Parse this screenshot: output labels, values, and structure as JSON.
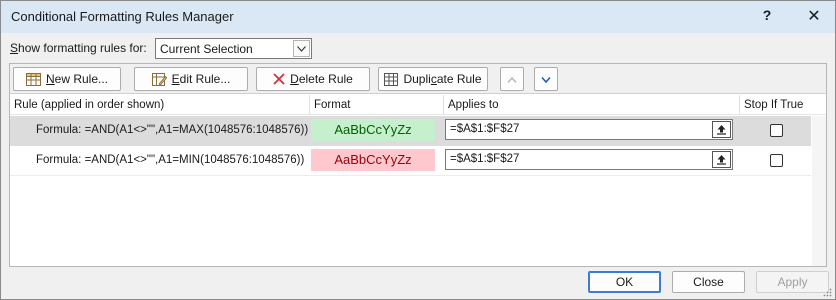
{
  "window": {
    "title": "Conditional Formatting Rules Manager",
    "help_label": "?",
    "close_label": "✕"
  },
  "filter": {
    "label_prefix": "S",
    "label_rest": "how formatting rules for:",
    "selected": "Current Selection"
  },
  "toolbar": {
    "new_rule_u": "N",
    "new_rule_rest": "ew Rule...",
    "edit_rule_u": "E",
    "edit_rule_rest": "dit Rule...",
    "delete_rule_u": "D",
    "delete_rule_rest": "elete Rule",
    "duplicate_a": "Dupli",
    "duplicate_u": "c",
    "duplicate_b": "ate Rule"
  },
  "columns": {
    "rule": "Rule (applied in order shown)",
    "format": "Format",
    "applies": "Applies to",
    "stop": "Stop If True"
  },
  "rules": [
    {
      "rule": "Formula: =AND(A1<>\"\",A1=MAX(1048576:1048576))",
      "preview": "AaBbCcYyZz",
      "applies_to": "=$A$1:$F$27",
      "stop_if_true": false,
      "selected": true,
      "fill": "#c6efce",
      "font_color": "#006100"
    },
    {
      "rule": "Formula: =AND(A1<>\"\",A1=MIN(1048576:1048576))",
      "preview": "AaBbCcYyZz",
      "applies_to": "=$A$1:$F$27",
      "stop_if_true": false,
      "selected": false,
      "fill": "#ffc7ce",
      "font_color": "#9c0006"
    }
  ],
  "buttons": {
    "ok": "OK",
    "close": "Close",
    "apply": "Apply"
  },
  "icons": [
    "new-rule-icon",
    "edit-rule-icon",
    "delete-rule-icon",
    "duplicate-rule-icon",
    "move-up-icon",
    "move-down-icon",
    "range-picker-icon",
    "dropdown-chevron-icon"
  ],
  "colors": {
    "titlebar": "#dae8f6",
    "selected_row": "#dcdcdc",
    "accent": "#3b7ad9"
  }
}
